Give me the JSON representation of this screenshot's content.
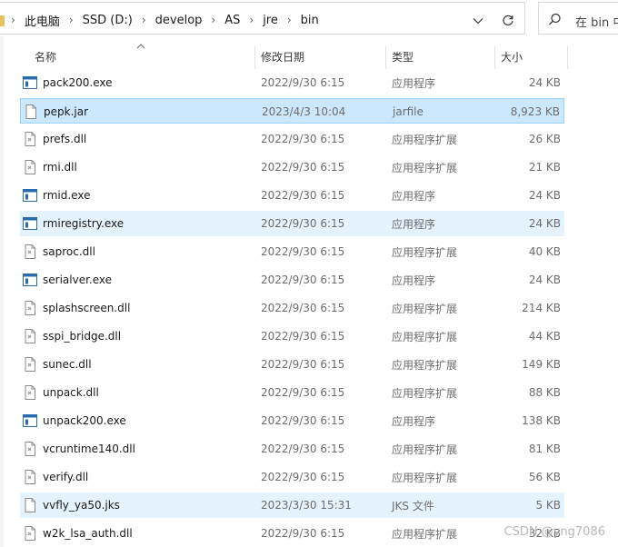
{
  "breadcrumb": {
    "items": [
      "此电脑",
      "SSD (D:)",
      "develop",
      "AS",
      "jre",
      "bin"
    ],
    "separator": "›"
  },
  "search": {
    "placeholder": "在 bin 中"
  },
  "columns": {
    "name": "名称",
    "date": "修改日期",
    "type": "类型",
    "size": "大小"
  },
  "files": [
    {
      "name": "pack200.exe",
      "date": "2022/9/30 6:15",
      "type": "应用程序",
      "size": "24 KB",
      "icon": "exe-icon",
      "state": ""
    },
    {
      "name": "pepk.jar",
      "date": "2023/4/3 10:04",
      "type": "jarfile",
      "size": "8,923 KB",
      "icon": "file-icon",
      "state": "selected"
    },
    {
      "name": "prefs.dll",
      "date": "2022/9/30 6:15",
      "type": "应用程序扩展",
      "size": "26 KB",
      "icon": "dll-icon",
      "state": ""
    },
    {
      "name": "rmi.dll",
      "date": "2022/9/30 6:15",
      "type": "应用程序扩展",
      "size": "21 KB",
      "icon": "dll-icon",
      "state": ""
    },
    {
      "name": "rmid.exe",
      "date": "2022/9/30 6:15",
      "type": "应用程序",
      "size": "24 KB",
      "icon": "exe-icon",
      "state": ""
    },
    {
      "name": "rmiregistry.exe",
      "date": "2022/9/30 6:15",
      "type": "应用程序",
      "size": "24 KB",
      "icon": "exe-icon",
      "state": "hover"
    },
    {
      "name": "saproc.dll",
      "date": "2022/9/30 6:15",
      "type": "应用程序扩展",
      "size": "40 KB",
      "icon": "dll-icon",
      "state": ""
    },
    {
      "name": "serialver.exe",
      "date": "2022/9/30 6:15",
      "type": "应用程序",
      "size": "24 KB",
      "icon": "exe-icon",
      "state": ""
    },
    {
      "name": "splashscreen.dll",
      "date": "2022/9/30 6:15",
      "type": "应用程序扩展",
      "size": "214 KB",
      "icon": "dll-icon",
      "state": ""
    },
    {
      "name": "sspi_bridge.dll",
      "date": "2022/9/30 6:15",
      "type": "应用程序扩展",
      "size": "44 KB",
      "icon": "dll-icon",
      "state": ""
    },
    {
      "name": "sunec.dll",
      "date": "2022/9/30 6:15",
      "type": "应用程序扩展",
      "size": "149 KB",
      "icon": "dll-icon",
      "state": ""
    },
    {
      "name": "unpack.dll",
      "date": "2022/9/30 6:15",
      "type": "应用程序扩展",
      "size": "88 KB",
      "icon": "dll-icon",
      "state": ""
    },
    {
      "name": "unpack200.exe",
      "date": "2022/9/30 6:15",
      "type": "应用程序",
      "size": "138 KB",
      "icon": "exe-icon",
      "state": ""
    },
    {
      "name": "vcruntime140.dll",
      "date": "2022/9/30 6:15",
      "type": "应用程序扩展",
      "size": "81 KB",
      "icon": "dll-icon",
      "state": ""
    },
    {
      "name": "verify.dll",
      "date": "2022/9/30 6:15",
      "type": "应用程序扩展",
      "size": "56 KB",
      "icon": "dll-icon",
      "state": ""
    },
    {
      "name": "vvfly_ya50.jks",
      "date": "2023/3/30 15:31",
      "type": "JKS 文件",
      "size": "5 KB",
      "icon": "file-icon",
      "state": "hover"
    },
    {
      "name": "w2k_lsa_auth.dll",
      "date": "2022/9/30 6:15",
      "type": "应用程序扩展",
      "size": "32 KB",
      "icon": "dll-icon",
      "state": ""
    }
  ],
  "watermark": "CSDN @yng7086",
  "colors": {
    "selected_bg": "#cce8ff",
    "selected_border": "#99d1ff",
    "hover_bg": "#e5f3ff",
    "muted_text": "#6d6d6d"
  }
}
